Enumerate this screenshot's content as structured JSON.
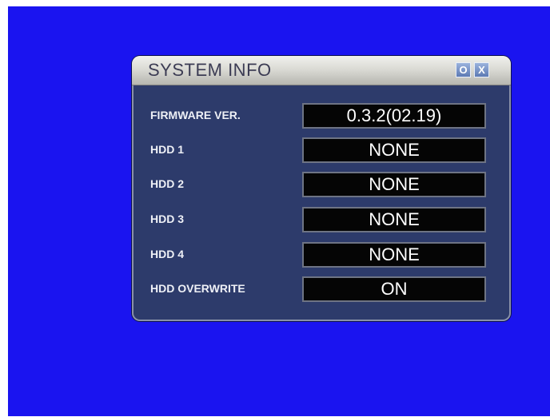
{
  "dialog": {
    "title": "SYSTEM INFO",
    "options_button_label": "O",
    "close_button_label": "X"
  },
  "rows": [
    {
      "label": "FIRMWARE VER.",
      "value": "0.3.2(02.19)"
    },
    {
      "label": "HDD 1",
      "value": "NONE"
    },
    {
      "label": "HDD 2",
      "value": "NONE"
    },
    {
      "label": "HDD 3",
      "value": "NONE"
    },
    {
      "label": "HDD 4",
      "value": "NONE"
    },
    {
      "label": "HDD OVERWRITE",
      "value": "ON"
    }
  ],
  "colors": {
    "screen_background": "#1a14f0",
    "dialog_body": "#2d3b6b",
    "value_box": "#050505"
  }
}
